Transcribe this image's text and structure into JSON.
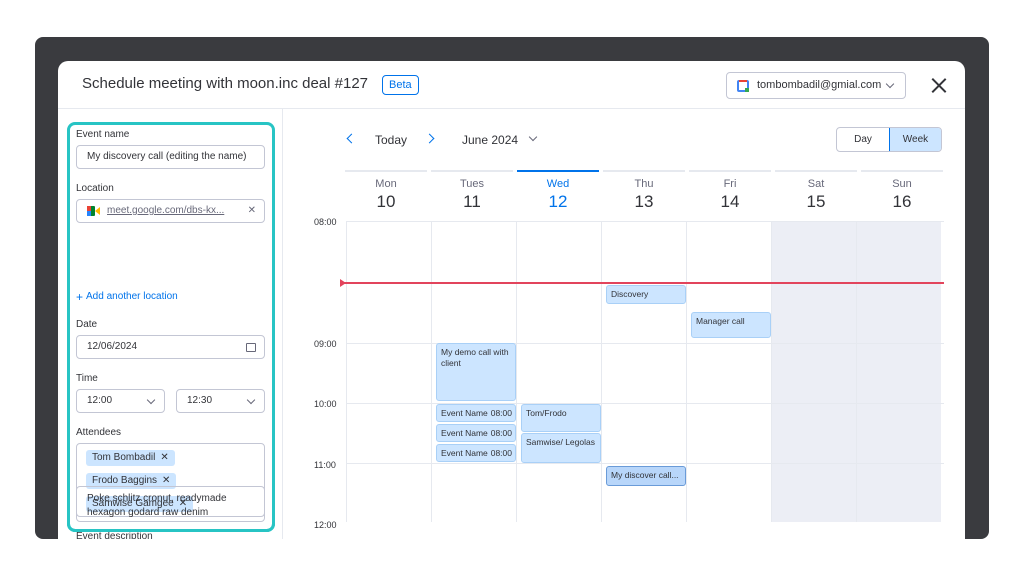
{
  "header": {
    "title": "Schedule meeting with moon.inc deal #127",
    "badge": "Beta",
    "account_email": "tombombadil@gmial.com"
  },
  "form": {
    "event_name_label": "Event name",
    "event_name_value": "My discovery call (editing the name)",
    "location_label": "Location",
    "location_value": "meet.google.com/dbs-kx...",
    "add_location": "Add another location",
    "date_label": "Date",
    "date_value": "12/06/2024",
    "time_label": "Time",
    "time_start": "12:00",
    "time_end": "12:30",
    "attendees_label": "Attendees",
    "attendees": [
      "Tom Bombadil",
      "Frodo Baggins",
      "Samwise Gamgee"
    ],
    "description_label": "Event description",
    "description_value": "Poke schlitz cronut, readymade hexagon godard raw denim"
  },
  "calendar": {
    "today_label": "Today",
    "month_label": "June 2024",
    "view_day": "Day",
    "view_week": "Week",
    "days": [
      {
        "name": "Mon",
        "date": "10"
      },
      {
        "name": "Tues",
        "date": "11"
      },
      {
        "name": "Wed",
        "date": "12"
      },
      {
        "name": "Thu",
        "date": "13"
      },
      {
        "name": "Fri",
        "date": "14"
      },
      {
        "name": "Sat",
        "date": "15"
      },
      {
        "name": "Sun",
        "date": "16"
      }
    ],
    "times": [
      "08:00",
      "09:00",
      "10:00",
      "11:00",
      "12:00"
    ],
    "events": {
      "discovery": "Discovery",
      "manager_call": "Manager call",
      "demo_call": "My demo call with client",
      "event_name_1": "Event Name",
      "event_name_1_time": "08:00",
      "event_name_2": "Event Name",
      "event_name_2_time": "08:00",
      "event_name_3": "Event Name",
      "event_name_3_time": "08:00",
      "tom_frodo": "Tom/Frodo",
      "samwise_legolas": "Samwise/ Legolas",
      "my_discover_call": "My discover call..."
    }
  },
  "colors": {
    "accent": "#0073ea",
    "highlight": "#27c4c4",
    "now_line": "#e2445c",
    "event_bg": "#cce5ff"
  }
}
